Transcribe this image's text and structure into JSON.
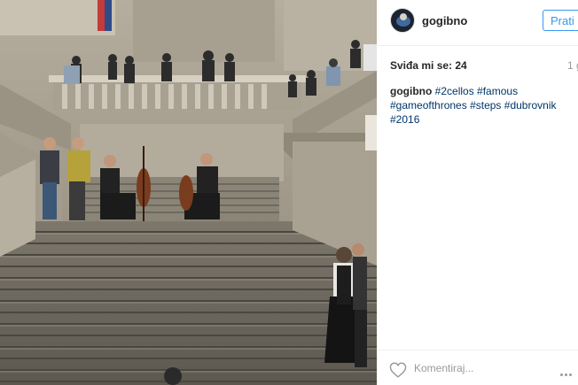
{
  "post": {
    "username": "gogibno",
    "follow_label": "Prati",
    "likes_text": "Sviđa mi se: 24",
    "timestamp": "1 g",
    "caption_author": "gogibno",
    "hashtags": [
      "#2cellos",
      "#famous",
      "#gameofthrones",
      "#steps",
      "#dubrovnik",
      "#2016"
    ],
    "comment_placeholder": "Komentiraj..."
  },
  "icons": {
    "heart": "heart-icon",
    "more": "more-options-icon",
    "avatar": "profile-avatar"
  },
  "colors": {
    "follow_button": "#3897f0",
    "hashtag": "#003569",
    "muted": "#999999"
  }
}
